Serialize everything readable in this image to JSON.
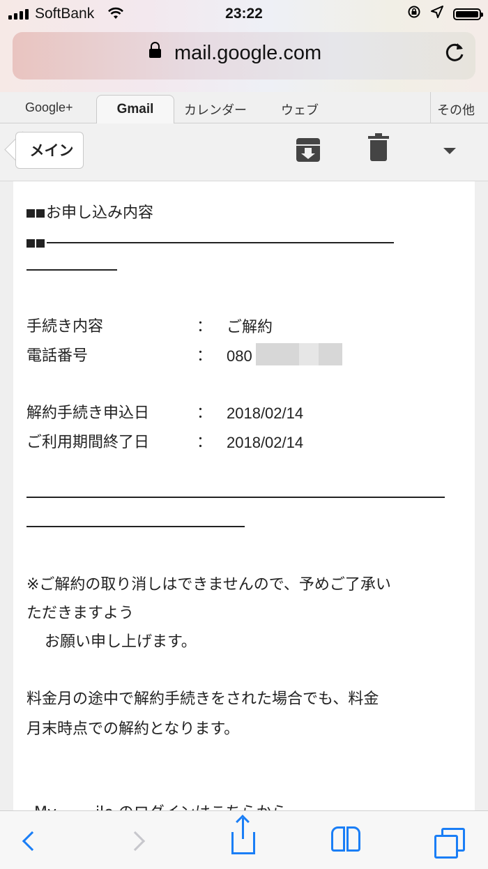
{
  "status_bar": {
    "carrier": "SoftBank",
    "time": "23:22"
  },
  "url_bar": {
    "url": "mail.google.com"
  },
  "tabs": {
    "items": [
      "Google+",
      "Gmail",
      "カレンダー",
      "ウェブ"
    ],
    "more": "その他",
    "active": "Gmail"
  },
  "toolbar": {
    "back_label": "メイン"
  },
  "email": {
    "section_title": "お申し込み内容",
    "rows": [
      {
        "label": "手続き内容",
        "colon": "：",
        "value": "ご解約"
      },
      {
        "label": "電話番号",
        "colon": "：",
        "value": "080"
      },
      {
        "label": "解約手続き申込日",
        "colon": "：",
        "value": "2018/02/14"
      },
      {
        "label": "ご利用期間終了日",
        "colon": "：",
        "value": "2018/02/14"
      }
    ],
    "note_line1": "※ご解約の取り消しはできませんので、予めご了承い",
    "note_line2": "ただきますよう",
    "note_line3": "お願い申し上げます。",
    "para_line1": "料金月の途中で解約手続きをされた場合でも、料金",
    "para_line2": "月末時点での解約となります。",
    "cut_line": "My ...... ile のログインはこちらから"
  }
}
